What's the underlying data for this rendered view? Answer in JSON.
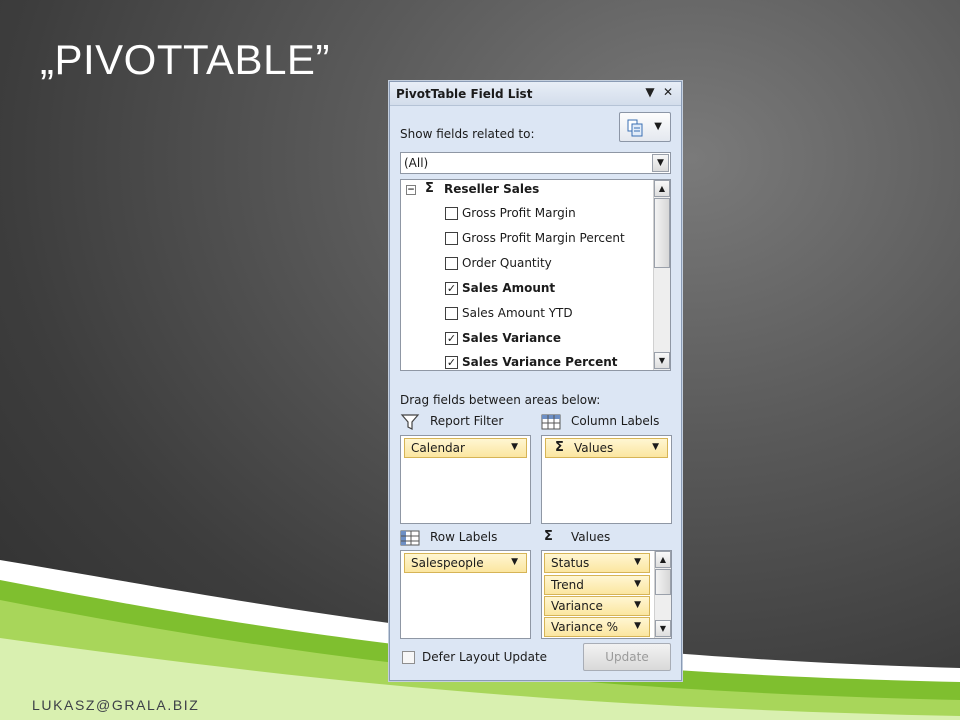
{
  "slide": {
    "title": "„PIVOTTABLE”",
    "footer": "LUKASZ@GRALA.BIZ"
  },
  "panel": {
    "title": "PivotTable Field List",
    "menu_glyph": "▼",
    "close_glyph": "✕",
    "show_fields_label": "Show fields related to:",
    "show_fields_value": "(All)",
    "dropdown_glyph": "▼",
    "tree": {
      "group_label": "Reseller Sales",
      "group_expander": "−",
      "sigma": "Σ",
      "fields": [
        {
          "label": "Gross Profit Margin",
          "checked": false
        },
        {
          "label": "Gross Profit Margin Percent",
          "checked": false
        },
        {
          "label": "Order Quantity",
          "checked": false
        },
        {
          "label": "Sales Amount",
          "checked": true
        },
        {
          "label": "Sales Amount YTD",
          "checked": false
        },
        {
          "label": "Sales Variance",
          "checked": true
        },
        {
          "label": "Sales Variance Percent",
          "checked": true
        }
      ],
      "check_glyph": "✓"
    },
    "drag_label": "Drag fields between areas below:",
    "areas": {
      "report_filter": {
        "label": "Report Filter",
        "items": [
          "Calendar"
        ]
      },
      "column_labels": {
        "label": "Column Labels",
        "items": [
          "Values"
        ]
      },
      "row_labels": {
        "label": "Row Labels",
        "items": [
          "Salespeople"
        ]
      },
      "values": {
        "label": "Values",
        "items": [
          "Status",
          "Trend",
          "Variance",
          "Variance %"
        ]
      }
    },
    "defer_label": "Defer Layout Update",
    "defer_checked": false,
    "update_label": "Update"
  },
  "colors": {
    "panel_bg": "#dce6f4",
    "pill_fill": "#fbe6a0",
    "pill_border": "#d6b456",
    "accent_green": "#8cc63f"
  }
}
